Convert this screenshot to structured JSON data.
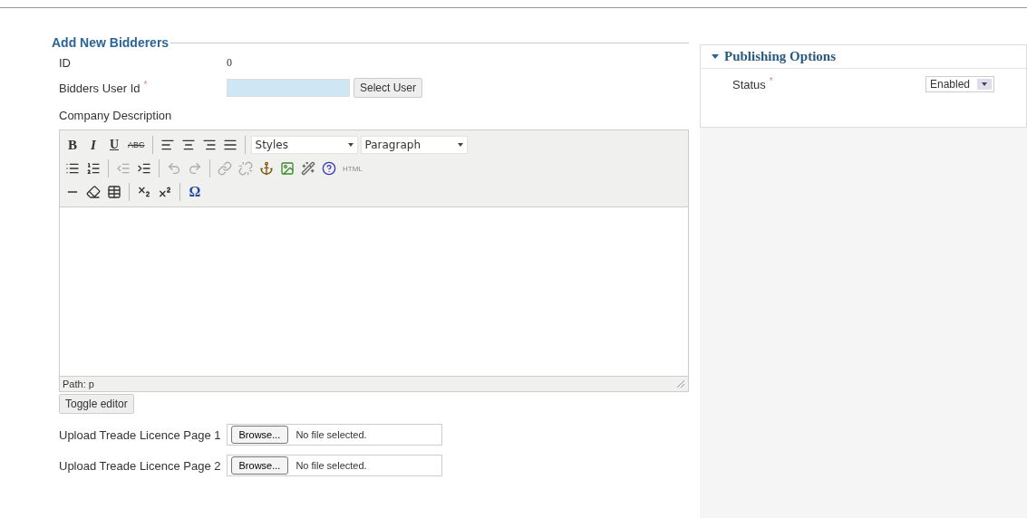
{
  "form": {
    "legend": "Add New Bidderers",
    "id_field": {
      "label": "ID",
      "value": "0"
    },
    "user_field": {
      "label": "Bidders User Id",
      "required_mark": "*",
      "button": "Select User"
    },
    "description": {
      "label": "Company Description",
      "toolbar_rows": [
        [
          {
            "kind": "label",
            "label": "B",
            "disabled": false
          },
          {
            "kind": "label",
            "label": "I",
            "disabled": false
          },
          {
            "kind": "label",
            "label": "U",
            "disabled": false
          },
          {
            "kind": "label",
            "label": "ABC",
            "disabled": false
          },
          {
            "kind": "sep"
          },
          {
            "kind": "icon",
            "disabled": false
          },
          {
            "kind": "icon",
            "disabled": false
          },
          {
            "kind": "icon",
            "disabled": false
          },
          {
            "kind": "icon",
            "disabled": false
          },
          {
            "kind": "sep"
          },
          {
            "kind": "select",
            "label": "Styles"
          },
          {
            "kind": "select",
            "label": "Paragraph"
          }
        ],
        [
          {
            "kind": "icon",
            "disabled": false
          },
          {
            "kind": "icon",
            "disabled": false
          },
          {
            "kind": "sep"
          },
          {
            "kind": "icon",
            "disabled": true
          },
          {
            "kind": "icon",
            "disabled": false
          },
          {
            "kind": "sep"
          },
          {
            "kind": "icon",
            "disabled": true
          },
          {
            "kind": "icon",
            "disabled": true
          },
          {
            "kind": "sep"
          },
          {
            "kind": "icon",
            "disabled": true
          },
          {
            "kind": "icon",
            "disabled": true
          },
          {
            "kind": "icon",
            "disabled": false
          },
          {
            "kind": "icon",
            "disabled": false
          },
          {
            "kind": "icon",
            "disabled": false
          },
          {
            "kind": "icon",
            "disabled": false
          },
          {
            "kind": "label",
            "label": "HTML",
            "disabled": false
          }
        ],
        [
          {
            "kind": "icon",
            "disabled": false
          },
          {
            "kind": "icon",
            "disabled": false
          },
          {
            "kind": "icon",
            "disabled": false
          },
          {
            "kind": "sep"
          },
          {
            "kind": "icon",
            "disabled": false
          },
          {
            "kind": "icon",
            "disabled": false
          },
          {
            "kind": "sep"
          },
          {
            "kind": "label",
            "label": "Ω",
            "disabled": false
          }
        ]
      ],
      "path": "Path: p",
      "toggle_button": "Toggle editor"
    },
    "uploads": [
      {
        "label": "Upload Treade Licence Page 1",
        "button": "Browse...",
        "status": "No file selected."
      },
      {
        "label": "Upload Treade Licence Page 2",
        "button": "Browse...",
        "status": "No file selected."
      }
    ]
  },
  "publishing": {
    "title": "Publishing Options",
    "expanded": true,
    "status_label": "Status",
    "required_mark": "*",
    "status_value": "Enabled"
  }
}
